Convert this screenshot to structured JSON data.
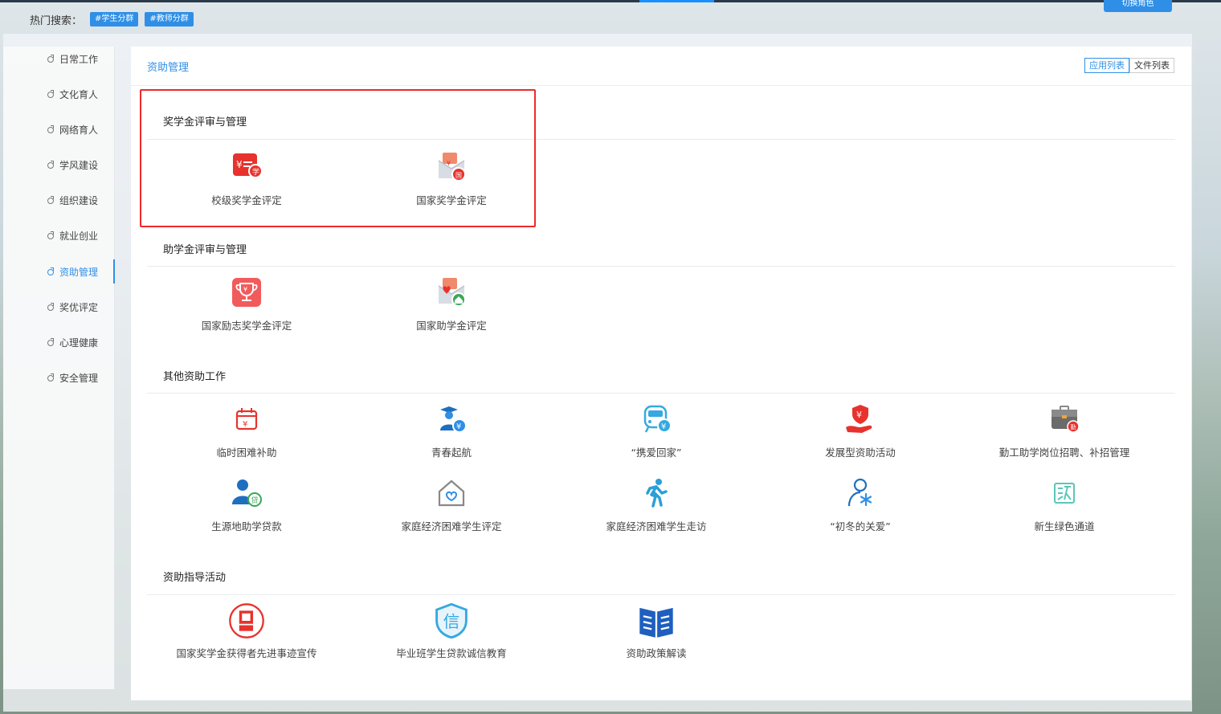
{
  "topbar": {
    "button_label": "切换角色"
  },
  "hot_search": {
    "label": "热门搜索：",
    "tags": [
      "#学生分群",
      "#教师分群"
    ]
  },
  "sidebar": {
    "items": [
      {
        "label": "日常工作"
      },
      {
        "label": "文化育人"
      },
      {
        "label": "网络育人"
      },
      {
        "label": "学风建设"
      },
      {
        "label": "组织建设"
      },
      {
        "label": "就业创业"
      },
      {
        "label": "资助管理",
        "active": true
      },
      {
        "label": "奖优评定"
      },
      {
        "label": "心理健康"
      },
      {
        "label": "安全管理"
      }
    ]
  },
  "panel": {
    "breadcrumb": "资助管理",
    "view_switch": {
      "app_list": "应用列表",
      "file_list": "文件列表",
      "selected": "应用列表"
    }
  },
  "sections": [
    {
      "title": "奖学金评审与管理",
      "apps": [
        {
          "label": "校级奖学金评定",
          "icon": "school-scholarship-icon"
        },
        {
          "label": "国家奖学金评定",
          "icon": "national-scholarship-icon"
        }
      ]
    },
    {
      "title": "助学金评审与管理",
      "apps": [
        {
          "label": "国家励志奖学金评定",
          "icon": "trophy-icon"
        },
        {
          "label": "国家助学金评定",
          "icon": "national-grant-icon"
        }
      ]
    },
    {
      "title": "其他资助工作",
      "apps": [
        {
          "label": "临时困难补助",
          "icon": "calendar-yuan-icon"
        },
        {
          "label": "青春起航",
          "icon": "graduate-yuan-icon"
        },
        {
          "label": "“携爱回家”",
          "icon": "train-yuan-icon"
        },
        {
          "label": "发展型资助活动",
          "icon": "hand-shield-yuan-icon"
        },
        {
          "label": "勤工助学岗位招聘、补招管理",
          "icon": "briefcase-icon"
        },
        {
          "label": "生源地助学贷款",
          "icon": "person-loan-icon"
        },
        {
          "label": "家庭经济困难学生评定",
          "icon": "house-heart-icon"
        },
        {
          "label": "家庭经济困难学生走访",
          "icon": "walking-person-icon"
        },
        {
          "label": "“初冬的关爱”",
          "icon": "person-snowflake-icon"
        },
        {
          "label": "新生绿色通道",
          "icon": "green-channel-icon"
        }
      ]
    },
    {
      "title": "资助指导活动",
      "apps": [
        {
          "label": "国家奖学金获得者先进事迹宣传",
          "icon": "book-circle-icon"
        },
        {
          "label": "毕业班学生贷款诚信教育",
          "icon": "shield-trust-icon"
        },
        {
          "label": "资助政策解读",
          "icon": "open-book-icon"
        }
      ]
    }
  ],
  "colors": {
    "accent": "#2f8fe6",
    "highlight": "#ee2b2b"
  }
}
